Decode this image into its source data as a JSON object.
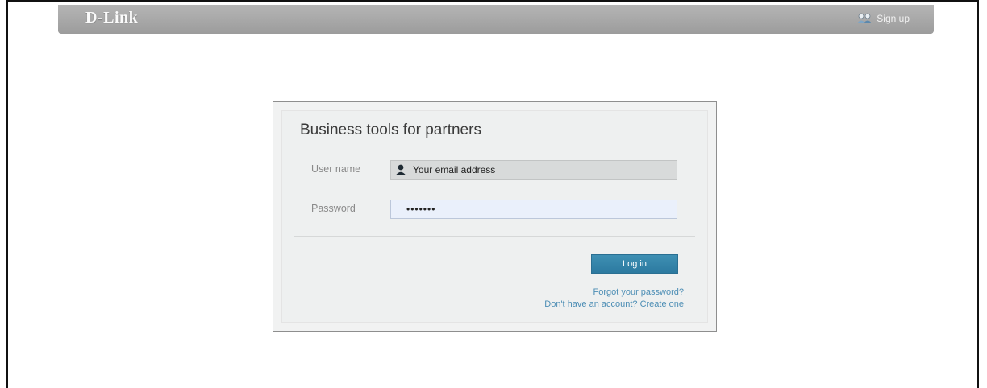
{
  "header": {
    "logo": "D-Link",
    "signup_label": "Sign up",
    "signup_icon": "people-icon"
  },
  "login": {
    "title": "Business tools for partners",
    "username_label": "User name",
    "username_placeholder": "Your email address",
    "username_icon": "user-icon",
    "password_label": "Password",
    "password_value": "•••••••",
    "login_button": "Log in",
    "forgot_link": "Forgot your password?",
    "create_link": "Don't have an account? Create one"
  },
  "colors": {
    "header_bar": "#a8a8a8",
    "panel_bg": "#f1f2f2",
    "button": "#3584ab",
    "link": "#4d8eb5"
  }
}
